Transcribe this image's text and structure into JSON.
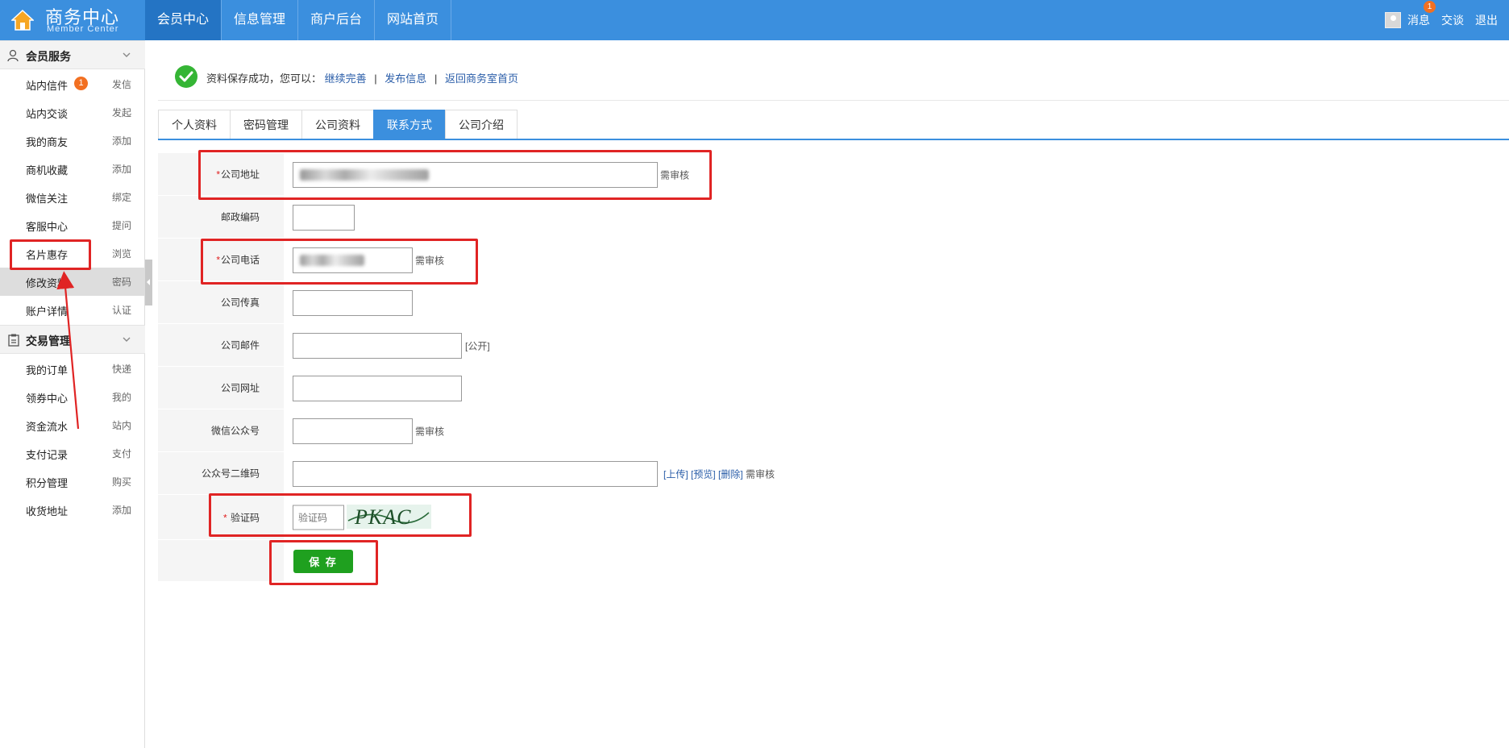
{
  "header": {
    "brand_title": "商务中心",
    "brand_subtitle": "Member Center",
    "nav": [
      "会员中心",
      "信息管理",
      "商户后台",
      "网站首页"
    ],
    "user_links": {
      "messages": "消息",
      "messages_badge": "1",
      "chat": "交谈",
      "logout": "退出"
    }
  },
  "sidebar": {
    "sections": [
      {
        "title": "会员服务",
        "items": [
          {
            "label": "站内信件",
            "action": "发信",
            "badge": "1"
          },
          {
            "label": "站内交谈",
            "action": "发起"
          },
          {
            "label": "我的商友",
            "action": "添加"
          },
          {
            "label": "商机收藏",
            "action": "添加"
          },
          {
            "label": "微信关注",
            "action": "绑定"
          },
          {
            "label": "客服中心",
            "action": "提问"
          },
          {
            "label": "名片惠存",
            "action": "浏览"
          },
          {
            "label": "修改资料",
            "action": "密码"
          },
          {
            "label": "账户详情",
            "action": "认证"
          }
        ]
      },
      {
        "title": "交易管理",
        "items": [
          {
            "label": "我的订单",
            "action": "快递"
          },
          {
            "label": "领券中心",
            "action": "我的"
          },
          {
            "label": "资金流水",
            "action": "站内"
          },
          {
            "label": "支付记录",
            "action": "支付"
          },
          {
            "label": "积分管理",
            "action": "购买"
          },
          {
            "label": "收货地址",
            "action": "添加"
          }
        ]
      }
    ]
  },
  "notice": {
    "text": "资料保存成功，您可以：",
    "links": [
      "继续完善",
      "发布信息",
      "返回商务室首页"
    ],
    "separator": "|"
  },
  "tabs": [
    "个人资料",
    "密码管理",
    "公司资料",
    "联系方式",
    "公司介绍"
  ],
  "form": {
    "required_mark": "*",
    "address_label": "公司地址",
    "address_hint": "需审核",
    "postcode_label": "邮政编码",
    "phone_label": "公司电话",
    "phone_hint": "需审核",
    "fax_label": "公司传真",
    "email_label": "公司邮件",
    "email_hint": "[公开]",
    "website_label": "公司网址",
    "wechat_label": "微信公众号",
    "wechat_hint": "需审核",
    "qrcode_label": "公众号二维码",
    "qrcode_upload": "[上传]",
    "qrcode_preview": "[预览]",
    "qrcode_delete": "[删除]",
    "qrcode_hint": "需审核",
    "captcha_label": "验证码",
    "captcha_placeholder": "验证码",
    "captcha_image_text": "PKAC",
    "save_label": "保 存"
  },
  "colors": {
    "header_bg": "#3b8fde",
    "nav_active_bg": "#2474c4",
    "save_button": "#1fa01f",
    "annotation_red": "#e02424",
    "badge_orange": "#f27022"
  }
}
